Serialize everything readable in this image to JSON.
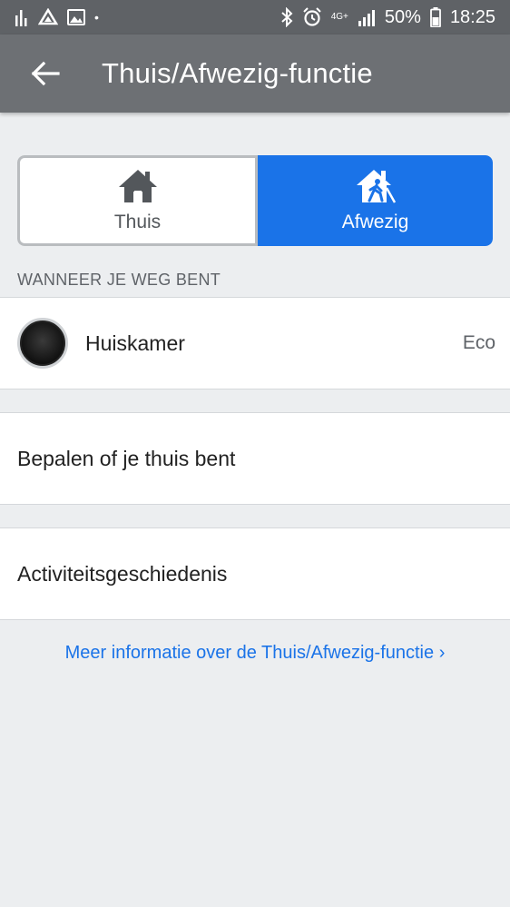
{
  "status_bar": {
    "network": "4G+",
    "battery": "50%",
    "time": "18:25"
  },
  "app_bar": {
    "title": "Thuis/Afwezig-functie"
  },
  "mode_toggle": {
    "home_label": "Thuis",
    "away_label": "Afwezig",
    "selected": "Afwezig",
    "accent_color": "#1a73e8"
  },
  "away_section": {
    "header": "WANNEER JE WEG BENT",
    "device": {
      "name": "Huiskamer",
      "mode": "Eco"
    }
  },
  "menu": {
    "determine_label": "Bepalen of je thuis bent",
    "history_label": "Activiteitsgeschiedenis"
  },
  "footer": {
    "more_info_link": "Meer informatie over de Thuis/Afwezig-functie",
    "chevron": "›"
  }
}
